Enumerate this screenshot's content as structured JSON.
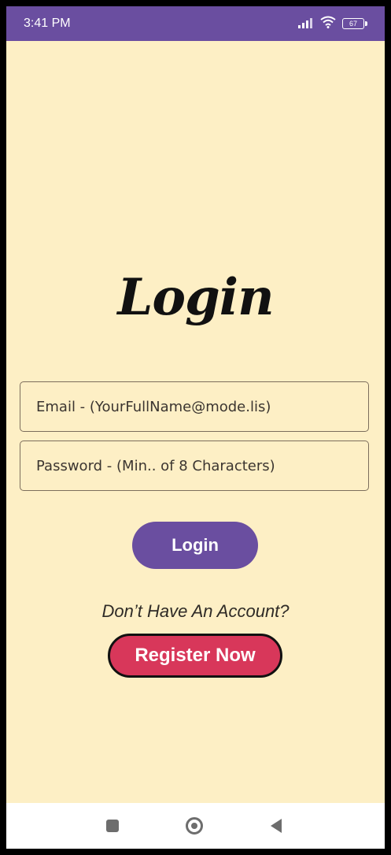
{
  "status_bar": {
    "time": "3:41 PM",
    "battery": "67",
    "icons": [
      "signal-icon",
      "wifi-icon",
      "battery-icon"
    ]
  },
  "page": {
    "title": "Login"
  },
  "form": {
    "email_placeholder": "Email - (YourFullName@mode.lis)",
    "password_placeholder": "Password - (Min.. of 8 Characters)",
    "login_label": "Login"
  },
  "footer": {
    "no_account_text": "Don’t Have An Account?",
    "register_label": "Register Now"
  },
  "nav_bar": {
    "icons": [
      "recents-square-icon",
      "home-circle-icon",
      "back-triangle-icon"
    ]
  },
  "colors": {
    "background": "#fdefc5",
    "accent": "#6a4ea0",
    "register": "#d8375a"
  }
}
